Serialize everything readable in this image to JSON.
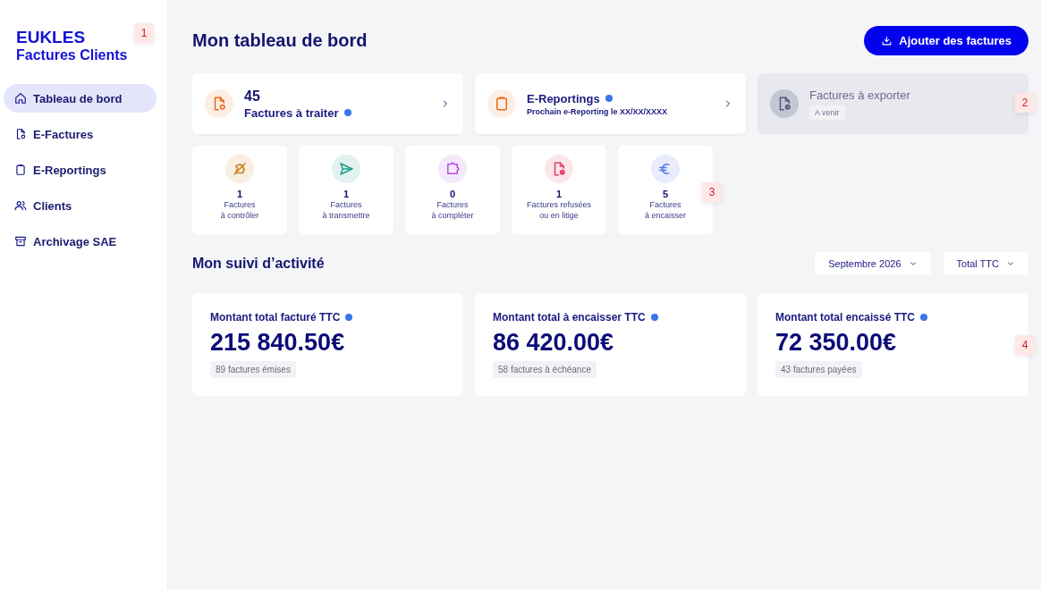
{
  "brand": {
    "name": "EUKLES",
    "product": "Factures Clients"
  },
  "sidebar": {
    "items": [
      {
        "label": "Tableau de bord",
        "selected": true
      },
      {
        "label": "E-Factures",
        "selected": false
      },
      {
        "label": "E-Reportings",
        "selected": false
      },
      {
        "label": "Clients",
        "selected": false
      },
      {
        "label": "Archivage SAE",
        "selected": false
      }
    ]
  },
  "header": {
    "title": "Mon tableau de bord",
    "button": "Ajouter des factures"
  },
  "summary_cards": [
    {
      "kind": "count",
      "value": "45",
      "label": "Factures à traiter",
      "info": true,
      "disabled": false
    },
    {
      "kind": "title",
      "title": "E-Reportings",
      "subtitle": "Prochain e-Reporting le XX/XX/XXXX",
      "info": true,
      "disabled": false
    },
    {
      "kind": "title",
      "title": "Factures à exporter",
      "badge": "A venir",
      "info": false,
      "disabled": true
    }
  ],
  "tiles": [
    {
      "count": "1",
      "label": "Factures\nà contrôler",
      "color": "#c9801f"
    },
    {
      "count": "1",
      "label": "Factures\nà transmettre",
      "color": "#1fa08c"
    },
    {
      "count": "0",
      "label": "Factures\nà compléter",
      "color": "#b44fe0"
    },
    {
      "count": "1",
      "label": "Factures refusées\nou en litige",
      "color": "#e0406a"
    },
    {
      "count": "5",
      "label": "Factures\nà encaisser",
      "color": "#4f6fe8"
    }
  ],
  "activity": {
    "title": "Mon suivi d’activité",
    "filters": [
      "Septembre 2026",
      "Total TTC"
    ],
    "metrics": [
      {
        "title": "Montant total facturé TTC",
        "info": true,
        "amount": "215 840.50€",
        "note": "89 factures émises"
      },
      {
        "title": "Montant total à encaisser TTC",
        "info": true,
        "amount": "86 420.00€",
        "note": "58 factures à échéance"
      },
      {
        "title": "Montant total encaissé TTC",
        "info": true,
        "amount": "72 350.00€",
        "note": "43 factures payées"
      }
    ]
  },
  "markers": [
    {
      "label": "1"
    },
    {
      "label": "2"
    },
    {
      "label": "3"
    },
    {
      "label": "4"
    }
  ]
}
